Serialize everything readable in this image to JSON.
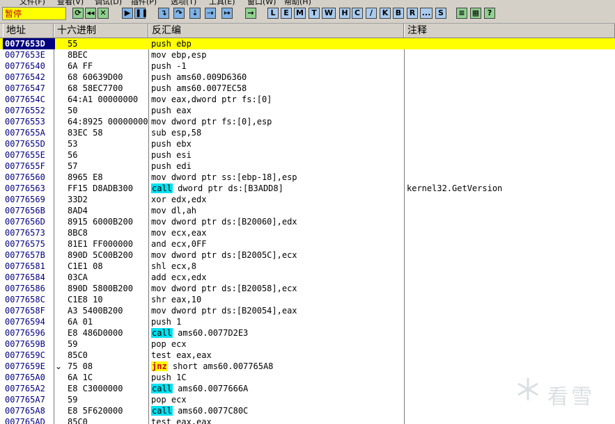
{
  "menu": [
    "文件(F)",
    "查看(V)",
    "调试(D)",
    "插件(P)",
    "选项(T)",
    "工具(E)",
    "窗口(W)",
    "帮助(H)"
  ],
  "status": "暂停",
  "toolbar_letters": [
    "L",
    "E",
    "M",
    "T",
    "W",
    "H",
    "C",
    "/",
    "K",
    "B",
    "R",
    "...",
    "S"
  ],
  "headers": {
    "address": "地址",
    "hex": "十六进制",
    "disasm": "反汇编",
    "comment": "注释"
  },
  "rows": [
    {
      "addr": "0077653D",
      "hex": "55",
      "pre": "",
      "hi": "",
      "post": "push ebp",
      "comment": ""
    },
    {
      "addr": "0077653E",
      "hex": "8BEC",
      "pre": "",
      "hi": "",
      "post": "mov ebp,esp",
      "comment": ""
    },
    {
      "addr": "00776540",
      "hex": "6A FF",
      "pre": "",
      "hi": "",
      "post": "push -1",
      "comment": ""
    },
    {
      "addr": "00776542",
      "hex": "68 60639D00",
      "pre": "",
      "hi": "",
      "post": "push ams60.009D6360",
      "comment": ""
    },
    {
      "addr": "00776547",
      "hex": "68 58EC7700",
      "pre": "",
      "hi": "",
      "post": "push ams60.0077EC58",
      "comment": ""
    },
    {
      "addr": "0077654C",
      "hex": "64:A1 00000000",
      "pre": "",
      "hi": "",
      "post": "mov eax,dword ptr fs:[0]",
      "comment": ""
    },
    {
      "addr": "00776552",
      "hex": "50",
      "pre": "",
      "hi": "",
      "post": "push eax",
      "comment": ""
    },
    {
      "addr": "00776553",
      "hex": "64:8925 00000000",
      "pre": "",
      "hi": "",
      "post": "mov dword ptr fs:[0],esp",
      "comment": ""
    },
    {
      "addr": "0077655A",
      "hex": "83EC 58",
      "pre": "",
      "hi": "",
      "post": "sub esp,58",
      "comment": ""
    },
    {
      "addr": "0077655D",
      "hex": "53",
      "pre": "",
      "hi": "",
      "post": "push ebx",
      "comment": ""
    },
    {
      "addr": "0077655E",
      "hex": "56",
      "pre": "",
      "hi": "",
      "post": "push esi",
      "comment": ""
    },
    {
      "addr": "0077655F",
      "hex": "57",
      "pre": "",
      "hi": "",
      "post": "push edi",
      "comment": ""
    },
    {
      "addr": "00776560",
      "hex": "8965 E8",
      "pre": "",
      "hi": "",
      "post": "mov dword ptr ss:[ebp-18],esp",
      "comment": ""
    },
    {
      "addr": "00776563",
      "hex": "FF15 D8ADB300",
      "pre": "",
      "hi": "call",
      "post": " dword ptr ds:[B3ADD8]",
      "comment": "kernel32.GetVersion"
    },
    {
      "addr": "00776569",
      "hex": "33D2",
      "pre": "",
      "hi": "",
      "post": "xor edx,edx",
      "comment": ""
    },
    {
      "addr": "0077656B",
      "hex": "8AD4",
      "pre": "",
      "hi": "",
      "post": "mov dl,ah",
      "comment": ""
    },
    {
      "addr": "0077656D",
      "hex": "8915 6000B200",
      "pre": "",
      "hi": "",
      "post": "mov dword ptr ds:[B20060],edx",
      "comment": ""
    },
    {
      "addr": "00776573",
      "hex": "8BC8",
      "pre": "",
      "hi": "",
      "post": "mov ecx,eax",
      "comment": ""
    },
    {
      "addr": "00776575",
      "hex": "81E1 FF000000",
      "pre": "",
      "hi": "",
      "post": "and ecx,0FF",
      "comment": ""
    },
    {
      "addr": "0077657B",
      "hex": "890D 5C00B200",
      "pre": "",
      "hi": "",
      "post": "mov dword ptr ds:[B2005C],ecx",
      "comment": ""
    },
    {
      "addr": "00776581",
      "hex": "C1E1 08",
      "pre": "",
      "hi": "",
      "post": "shl ecx,8",
      "comment": ""
    },
    {
      "addr": "00776584",
      "hex": "03CA",
      "pre": "",
      "hi": "",
      "post": "add ecx,edx",
      "comment": ""
    },
    {
      "addr": "00776586",
      "hex": "890D 5800B200",
      "pre": "",
      "hi": "",
      "post": "mov dword ptr ds:[B20058],ecx",
      "comment": ""
    },
    {
      "addr": "0077658C",
      "hex": "C1E8 10",
      "pre": "",
      "hi": "",
      "post": "shr eax,10",
      "comment": ""
    },
    {
      "addr": "0077658F",
      "hex": "A3 5400B200",
      "pre": "",
      "hi": "",
      "post": "mov dword ptr ds:[B20054],eax",
      "comment": ""
    },
    {
      "addr": "00776594",
      "hex": "6A 01",
      "pre": "",
      "hi": "",
      "post": "push 1",
      "comment": ""
    },
    {
      "addr": "00776596",
      "hex": "E8 486D0000",
      "pre": "",
      "hi": "call",
      "post": " ams60.0077D2E3",
      "comment": ""
    },
    {
      "addr": "0077659B",
      "hex": "59",
      "pre": "",
      "hi": "",
      "post": "pop ecx",
      "comment": ""
    },
    {
      "addr": "0077659C",
      "hex": "85C0",
      "pre": "",
      "hi": "",
      "post": "test eax,eax",
      "comment": ""
    },
    {
      "addr": "0077659E",
      "hex": "75 08",
      "pre": "",
      "hi": "jnz",
      "post": " short ams60.007765A8",
      "comment": ""
    },
    {
      "addr": "007765A0",
      "hex": "6A 1C",
      "pre": "",
      "hi": "",
      "post": "push 1C",
      "comment": ""
    },
    {
      "addr": "007765A2",
      "hex": "E8 C3000000",
      "pre": "",
      "hi": "call",
      "post": " ams60.0077666A",
      "comment": ""
    },
    {
      "addr": "007765A7",
      "hex": "59",
      "pre": "",
      "hi": "",
      "post": "pop ecx",
      "comment": ""
    },
    {
      "addr": "007765A8",
      "hex": "E8 5F620000",
      "pre": "",
      "hi": "call",
      "post": " ams60.0077C80C",
      "comment": ""
    },
    {
      "addr": "007765AD",
      "hex": "85C0",
      "pre": "",
      "hi": "",
      "post": "test eax,eax",
      "comment": ""
    }
  ],
  "selected_row": 0,
  "jump_marker_row": 29,
  "watermark": "看雪"
}
